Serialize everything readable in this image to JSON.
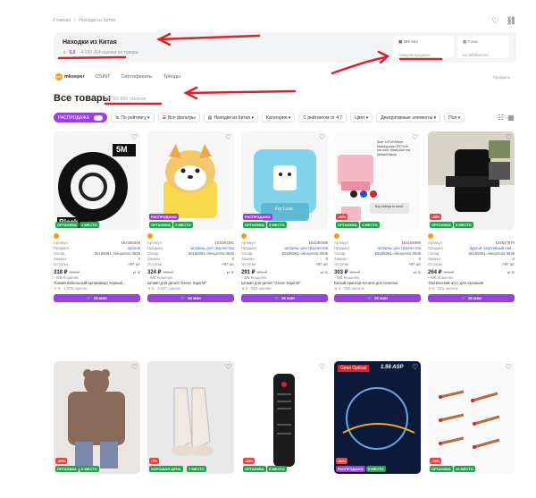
{
  "breadcrumbs": [
    "Главная",
    "/",
    "Находки из Китая"
  ],
  "hero": {
    "title": "Находки из Китая",
    "rating": "5,0",
    "reviews": "· 4 160 494 оценки на товары",
    "sold": "489 664",
    "sold_label": "товаров продано",
    "age": "7 мес",
    "age_label": "на Wildberries"
  },
  "tabs": {
    "brand": "mkeeper",
    "items": [
      "OSINT",
      "Сертификаты",
      "Тренды"
    ],
    "right": "Профиль ·"
  },
  "main": {
    "title": "Все товары",
    "count": "27 503 889 товаров"
  },
  "filters": [
    "РАСПРОДАЖА",
    "По рейтингу ▾",
    "Все фильтры",
    "Находки из Китая ▾",
    "Категория ▾",
    "С рейтингом от 4,7",
    "Цвет ▾",
    "Декоративные элементы ▾",
    "Пол ▾"
  ],
  "labels": {
    "article": "Артикул",
    "subject": "Предмет",
    "warehouse": "Склад",
    "orders": "Заказы",
    "stock": "Остатки",
    "seller": "WB Кошелек",
    "button": "15 мин"
  },
  "colors": {
    "accent": "#9b3fe0",
    "green": "#1fa64a",
    "arrow": "#d8232a"
  },
  "products": [
    {
      "badge1": "ОРГАНИКА",
      "badge2": "1 МЕСТО",
      "article": "102456049",
      "subject": "Кабели",
      "warehouse": "50185061-Aliexpress-3535",
      "orders": "0",
      "stock": ">97 шт",
      "price": "318 ₽",
      "old": "328 ₽",
      "name": "Тонкий Кабельный органайзер черный...",
      "reviews": "5 · 1 076 оценок"
    },
    {
      "badge0": "РАСПРОДАЖА",
      "badge1": "ОРГАНИКА",
      "badge2": "2 МЕСТО",
      "article": "103190381",
      "subject": "Штампы для творчества",
      "warehouse": "50185061-Aliexpress-3535",
      "orders": "0",
      "stock": ">97 шт",
      "price": "324 ₽",
      "old": "335 ₽",
      "name": "Штамп для детей \"Green Squirrel\"",
      "reviews": "5 · 1 047 оценок"
    },
    {
      "badge0": "РАСПРОДАЖА",
      "badge1": "ОРГАНИКА",
      "badge2": "3 МЕСТО",
      "article": "103190388",
      "subject": "Штампы для творчества",
      "warehouse": "50185061-Aliexpress-3535",
      "orders": "0",
      "stock": ">97 шт",
      "price": "291 ₽",
      "old": "301 ₽",
      "name": "Штамп для детей \"Green Squirrel\"",
      "reviews": "5 · 853 оценки"
    },
    {
      "badge0": "-49%",
      "badge1": "ОРГАНИКА",
      "badge2": "4 МЕСТО",
      "article": "102105986",
      "subject": "Штампы для творчества",
      "warehouse": "50185061-Aliexpress-3535",
      "orders": "0",
      "stock": ">97 шт",
      "price": "303 ₽",
      "old": "314 ₽",
      "name": "Белый принтер-печати для пеленок",
      "reviews": "5 · 840 оценок"
    },
    {
      "badge0": "-49%",
      "badge1": "ОРГАНИКА",
      "badge2": "5 МЕСТО",
      "article": "103627870",
      "subject": "Другой спортивный инв...",
      "warehouse": "50185061-Aliexpress-3535",
      "orders": "0",
      "stock": ">97 шт",
      "price": "264 ₽",
      "old": "546 ₽",
      "name": "Тактический жгут для оказания",
      "reviews": "5 · 631 оценок"
    }
  ],
  "row2": [
    {
      "badge0": "-24%",
      "badge1": "ОРГАНИКА",
      "badge2": "6 МЕСТО"
    },
    {
      "badge0": "-7%",
      "badge1": "ХОРОШАЯ ЦЕНА",
      "badge2": "7 МЕСТО"
    },
    {
      "badge0": "-24%",
      "badge1": "ОРГАНИКА",
      "badge2": "8 МЕСТО"
    },
    {
      "badge0": "-94%",
      "badge1": "РАСПРОДАЖА",
      "badge2": "9 МЕСТО",
      "title": "Gmei Optical",
      "sub": "1.56 ASP"
    },
    {
      "badge0": "-19%",
      "badge1": "ОРГАНИКА",
      "badge2": "10 МЕСТО"
    }
  ],
  "images": {
    "cable": "5M",
    "cable_label": "Black",
    "stamp3": "For Love",
    "stamp4a": "Size: 10*19*29mm",
    "stamp4b": "Marking size: 8*17mm",
    "stamp4c": "Ink color: black,blue,red",
    "stamp4d": "(default black)",
    "stamp4e": "Buy stamps to send"
  }
}
